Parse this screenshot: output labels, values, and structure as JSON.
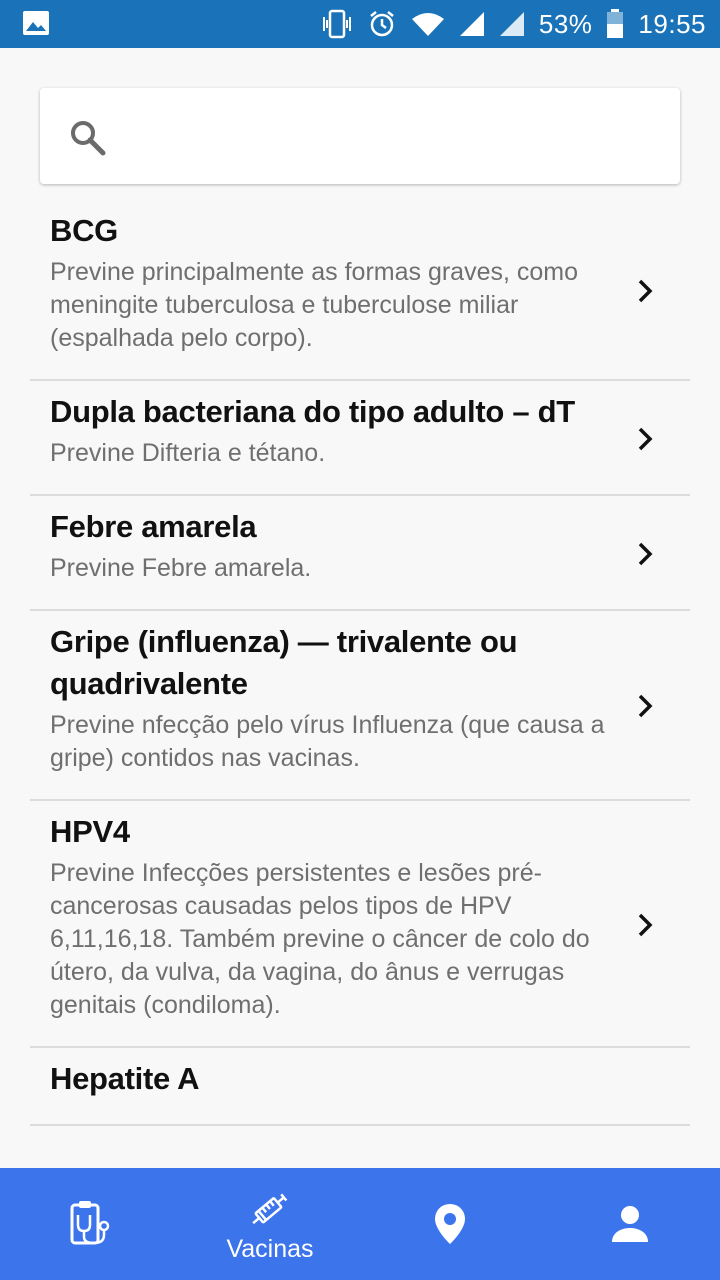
{
  "status_bar": {
    "battery": "53%",
    "time": "19:55"
  },
  "search": {
    "placeholder": ""
  },
  "items": [
    {
      "title": "BCG",
      "desc": "Previne principalmente as formas graves, como meningite tuberculosa e tuberculose miliar (espalhada pelo corpo)."
    },
    {
      "title": "Dupla bacteriana do tipo adulto – dT",
      "desc": "Previne Difteria e tétano."
    },
    {
      "title": "Febre amarela",
      "desc": "Previne Febre amarela."
    },
    {
      "title": "Gripe (influenza) — trivalente ou quadrivalente",
      "desc": "Previne nfecção pelo vírus Influenza (que causa a gripe) contidos nas vacinas."
    },
    {
      "title": "HPV4",
      "desc": "Previne Infecções persistentes e lesões pré-cancerosas causadas pelos tipos de HPV 6,11,16,18. Também previne o câncer de colo do útero, da vulva, da vagina, do ânus e verrugas genitais (condiloma)."
    },
    {
      "title": "Hepatite A",
      "desc": ""
    }
  ],
  "bottom_nav": {
    "active_label": "Vacinas",
    "icons": [
      "clipboard-stethoscope-icon",
      "syringe-icon",
      "location-pin-icon",
      "person-icon"
    ]
  },
  "colors": {
    "status_bar": "#1a73b8",
    "bottom_nav": "#3c74ec"
  }
}
